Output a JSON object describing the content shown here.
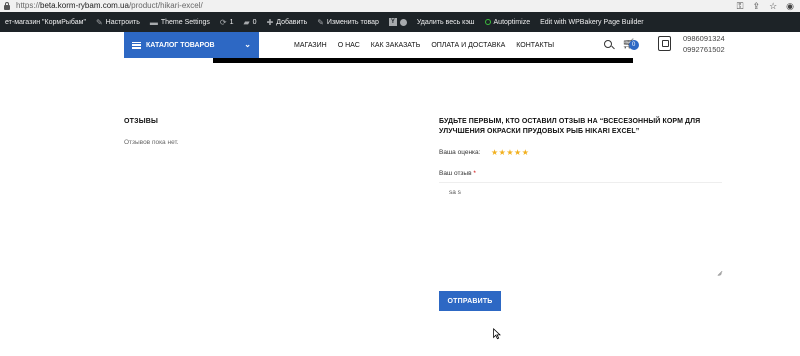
{
  "browser": {
    "url_prefix": "https://",
    "url_domain": "beta.korm-rybam.com.ua",
    "url_path": "/product/hikari-excel/",
    "icons": [
      "key-icon",
      "share-icon",
      "star-icon",
      "profile-icon"
    ]
  },
  "admin_bar": {
    "site_name": "ет-магазин \"КормРыбам\"",
    "customize": "Настроить",
    "theme_settings": "Theme Settings",
    "updates_count": "1",
    "comments_count": "0",
    "add_new": "Добавить",
    "edit_product": "Изменить товар",
    "clear_cache": "Удалить весь кэш",
    "autoptimize": "Autoptimize",
    "wpbakery": "Edit with WPBakery Page Builder"
  },
  "header": {
    "catalog_label": "КАТАЛОГ ТОВАРОВ",
    "nav": [
      "МАГАЗИН",
      "О НАС",
      "КАК ЗАКАЗАТЬ",
      "ОПЛАТА И ДОСТАВКА",
      "КОНТАКТЫ"
    ],
    "cart_count": "0",
    "phone_1": "0986091324",
    "phone_2": "0992761502"
  },
  "reviews": {
    "title": "ОТЗЫВЫ",
    "empty_text": "Отзывов пока нет."
  },
  "review_form": {
    "title": "БУДЬТЕ ПЕРВЫМ, КТО ОСТАВИЛ ОТЗЫВ НА “ВСЕСЕЗОННЫЙ КОРМ ДЛЯ УЛУЧШЕНИЯ ОКРАСКИ ПРУДОВЫХ РЫБ HIKARI EXCEL”",
    "rating_label": "Ваша оценка",
    "rating_stars": 5,
    "review_label": "Ваш отзыв",
    "required_mark": "*",
    "review_value": "sa s",
    "submit_label": "ОТПРАВИТЬ"
  },
  "colors": {
    "accent": "#2d68c4",
    "admin_bar": "#1d2327",
    "stars": "#f2b01e"
  }
}
